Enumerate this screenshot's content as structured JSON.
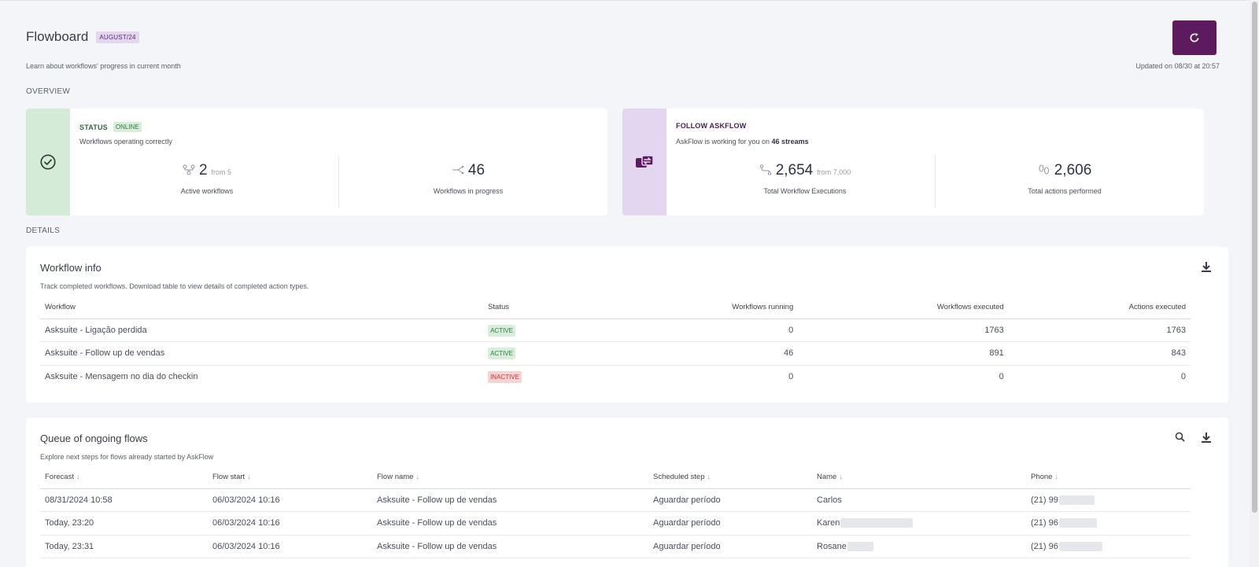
{
  "header": {
    "title": "Flowboard",
    "month_badge": "AUGUST/24",
    "subtitle": "Learn about workflows' progress in current month",
    "updated": "Updated on 08/30 at 20:57",
    "refresh_icon": "refresh-icon"
  },
  "sections": {
    "overview": "OVERVIEW",
    "details": "DETAILS"
  },
  "status_card": {
    "title": "STATUS",
    "badge": "ONLINE",
    "description": "Workflows operating correctly",
    "icon": "check-circle-icon",
    "metrics": [
      {
        "value": "2",
        "sub": "from 5",
        "label": "Active workflows",
        "icon": "workflow-icon"
      },
      {
        "value": "46",
        "sub": "",
        "label": "Workflows in progress",
        "icon": "share-icon"
      }
    ],
    "accent": "#d4ebd8"
  },
  "askflow_card": {
    "title": "FOLLOW ASKFLOW",
    "description_prefix": "AskFlow is working for you on ",
    "description_bold": "46 streams",
    "icon": "sync-icon",
    "metrics": [
      {
        "value": "2,654",
        "sub": "from 7,000",
        "label": "Total Workflow Executions",
        "icon": "route-icon"
      },
      {
        "value": "2,606",
        "sub": "",
        "label": "Total actions performed",
        "icon": "footprints-icon"
      }
    ],
    "accent": "#e3d6ee"
  },
  "workflow_info": {
    "title": "Workflow info",
    "description": "Track completed workflows. Download table to view details of completed action types.",
    "download_icon": "download-icon",
    "columns": [
      "Workflow",
      "Status",
      "Workflows running",
      "Workflows executed",
      "Actions executed"
    ],
    "rows": [
      {
        "workflow": "Asksuite - Ligação perdida",
        "status": "ACTIVE",
        "running": "0",
        "executed": "1763",
        "actions": "1763"
      },
      {
        "workflow": "Asksuite - Follow up de vendas",
        "status": "ACTIVE",
        "running": "46",
        "executed": "891",
        "actions": "843"
      },
      {
        "workflow": "Asksuite - Mensagem no dia do checkin",
        "status": "INACTIVE",
        "running": "0",
        "executed": "0",
        "actions": "0"
      }
    ]
  },
  "queue": {
    "title": "Queue of ongoing flows",
    "description": "Explore next steps for flows already started by AskFlow",
    "search_icon": "search-icon",
    "download_icon": "download-icon",
    "columns": [
      "Forecast",
      "Flow start",
      "Flow name",
      "Scheduled step",
      "Name",
      "Phone"
    ],
    "rows": [
      {
        "forecast": "08/31/2024 10:58",
        "flow_start": "06/03/2024 10:16",
        "flow_name": "Asksuite - Follow up de vendas",
        "step": "Aguardar período",
        "name": "Carlos",
        "phone": "(21) 99"
      },
      {
        "forecast": "Today, 23:20",
        "flow_start": "06/03/2024 10:16",
        "flow_name": "Asksuite - Follow up de vendas",
        "step": "Aguardar período",
        "name": "Karen",
        "phone": "(21) 96"
      },
      {
        "forecast": "Today, 23:31",
        "flow_start": "06/03/2024 10:16",
        "flow_name": "Asksuite - Follow up de vendas",
        "step": "Aguardar período",
        "name": "Rosane",
        "phone": "(21) 96"
      }
    ]
  }
}
